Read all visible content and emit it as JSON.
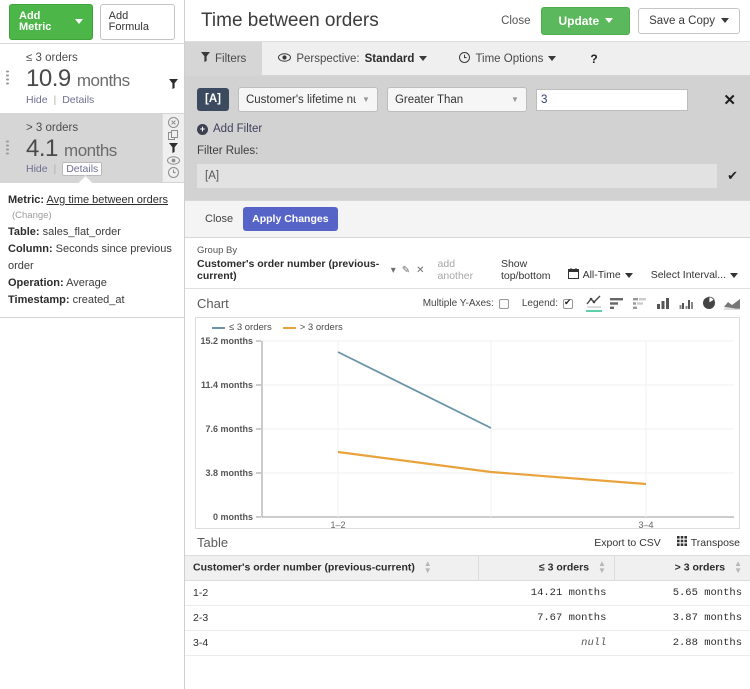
{
  "sidebar": {
    "toolbar": {
      "add_metric": "Add Metric",
      "add_formula": "Add Formula"
    },
    "cards": [
      {
        "label": "≤ 3 orders",
        "value": "10.9",
        "unit": "months",
        "hide": "Hide",
        "details": "Details"
      },
      {
        "label": "> 3 orders",
        "value": "4.1",
        "unit": "months",
        "hide": "Hide",
        "details": "Details"
      }
    ],
    "details": {
      "metric_key": "Metric:",
      "metric_value": "Avg time between orders",
      "change": "(Change)",
      "table_key": "Table:",
      "table_value": "sales_flat_order",
      "column_key": "Column:",
      "column_value": "Seconds since previous order",
      "operation_key": "Operation:",
      "operation_value": "Average",
      "timestamp_key": "Timestamp:",
      "timestamp_value": "created_at"
    }
  },
  "header": {
    "title": "Time between orders",
    "close": "Close",
    "update": "Update",
    "save_copy": "Save a Copy"
  },
  "tabs": [
    {
      "label": "Filters",
      "icon": "filter-icon"
    },
    {
      "label": "Perspective:",
      "value": "Standard",
      "icon": "eye-icon"
    },
    {
      "label": "Time Options",
      "icon": "clock-icon"
    },
    {
      "label": "?",
      "icon": "help-icon"
    }
  ],
  "filter_panel": {
    "tag": "[A]",
    "field": "Customer's lifetime num...",
    "operator": "Greater Than",
    "value": "3",
    "add_filter": "Add Filter",
    "filter_rules_label": "Filter Rules:",
    "rule_expression": "[A]",
    "close": "Close",
    "apply": "Apply Changes"
  },
  "groupby": {
    "caption": "Group By",
    "dimension": "Customer's order number (previous-current)",
    "add_another": "add another",
    "show_top_bottom": "Show top/bottom",
    "time_range": "All-Time",
    "interval": "Select Interval..."
  },
  "chart_panel": {
    "caption": "Chart",
    "multiple_y_axes_label": "Multiple Y-Axes:",
    "multiple_y_axes_checked": false,
    "legend_label": "Legend:",
    "legend_checked": true,
    "types": [
      "line-chart-icon",
      "horizontal-bar-chart-icon",
      "stacked-bar-chart-icon",
      "column-chart-icon",
      "grouped-column-chart-icon",
      "pie-chart-icon",
      "area-chart-icon"
    ],
    "active_type": "line-chart-icon"
  },
  "table_panel": {
    "caption": "Table",
    "export_csv": "Export to CSV",
    "transpose": "Transpose",
    "columns": [
      "Customer's order number (previous-current)",
      "≤ 3 orders",
      "> 3 orders"
    ],
    "rows": [
      {
        "group": "1-2",
        "le3": "14.21  months",
        "gt3": "5.65  months"
      },
      {
        "group": "2-3",
        "le3": "7.67  months",
        "gt3": "3.87  months"
      },
      {
        "group": "3-4",
        "le3": "null",
        "gt3": "2.88  months"
      }
    ]
  },
  "chart_data": {
    "type": "line",
    "title": "",
    "xlabel": "",
    "ylabel": "months",
    "categories": [
      "1-2",
      "2-3",
      "3-4"
    ],
    "xtick_labels": [
      "1-2",
      "3-4"
    ],
    "ytick_labels": [
      "15.2 months",
      "11.4 months",
      "7.6 months",
      "3.8 months",
      "0 months"
    ],
    "ylim": [
      0,
      15.2
    ],
    "yticks": [
      0,
      3.8,
      7.6,
      11.4,
      15.2
    ],
    "grid": true,
    "legend": "top-left",
    "series": [
      {
        "name": "≤ 3 orders",
        "color": "#6a93ab",
        "values": [
          14.21,
          7.67,
          null
        ]
      },
      {
        "name": "> 3 orders",
        "color": "#e8a33d",
        "values": [
          5.65,
          3.87,
          2.88
        ]
      }
    ]
  },
  "colors": {
    "accent_green": "#4cb748",
    "update_green": "#5cb85c",
    "apply_blue": "#5664c8",
    "tag_navy": "#3c4a60",
    "series_blue": "#6a93ab",
    "series_orange": "#e8a33d",
    "active_tab_underline": "#5fcfa8"
  }
}
